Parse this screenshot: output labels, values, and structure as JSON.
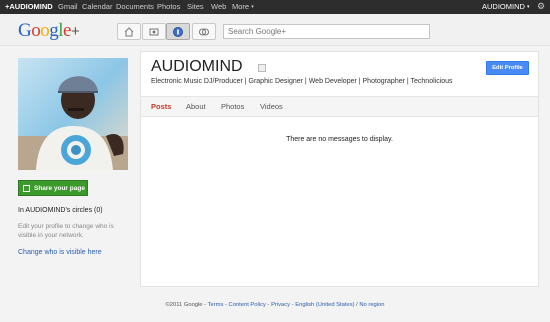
{
  "topbar": {
    "brand": "+AUDIOMIND",
    "nav": [
      "Gmail",
      "Calendar",
      "Documents",
      "Photos",
      "Sites",
      "Web",
      "More"
    ],
    "more_caret": "▾",
    "user": "AUDIOMIND",
    "user_caret": "▾",
    "gear": "⚙"
  },
  "header": {
    "logo_letters": [
      "G",
      "o",
      "o",
      "g",
      "l",
      "e"
    ],
    "logo_plus": "+",
    "search_placeholder": "Search Google+"
  },
  "sidebar": {
    "share_label": "Share your page",
    "circles_text": "In AUDIOMIND's circles (0)",
    "hint_text": "Edit your profile to change who is visible in your network.",
    "change_link": "Change who is visible here"
  },
  "profile": {
    "name": "AUDIOMIND",
    "tagline": "Electronic Music DJ/Producer | Graphic Designer | Web Developer | Photographer | Technolicious",
    "edit_label": "Edit Profile",
    "tabs": [
      "Posts",
      "About",
      "Photos",
      "Videos"
    ],
    "active_tab": "Posts",
    "empty_message": "There are no messages to display."
  },
  "footer": {
    "copyright": "©2011 Google",
    "sep": " - ",
    "links": [
      "Terms",
      "Content Policy",
      "Privacy",
      "English (United States)"
    ],
    "last": "No region"
  },
  "colors": {
    "accent_blue": "#4a8af4",
    "share_green": "#3c9a2c",
    "active_tab": "#c53929"
  }
}
